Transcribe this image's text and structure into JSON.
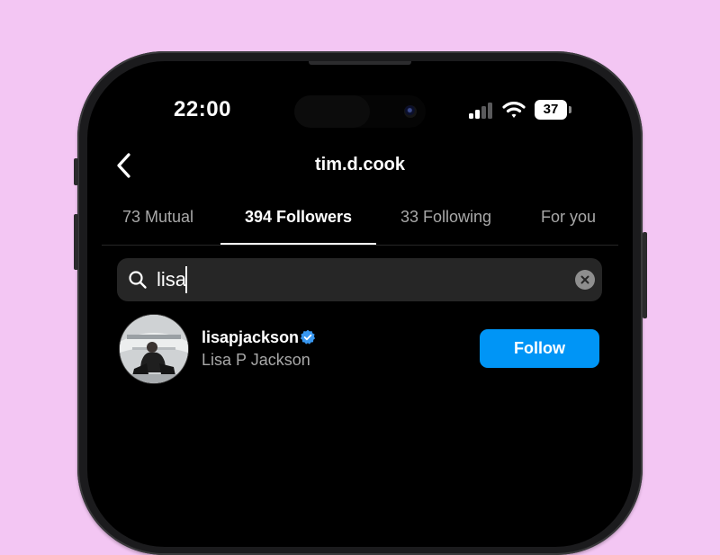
{
  "status_bar": {
    "time": "22:00",
    "battery_level": "37",
    "icons": [
      "cellular-signal-icon",
      "wifi-icon",
      "battery-icon"
    ]
  },
  "header": {
    "title": "tim.d.cook",
    "back_icon": "chevron-left-icon"
  },
  "tabs": [
    {
      "label": "73 Mutual",
      "active": false
    },
    {
      "label": "394 Followers",
      "active": true
    },
    {
      "label": "33 Following",
      "active": false
    },
    {
      "label": "For you",
      "active": false
    }
  ],
  "search": {
    "value": "lisa",
    "icons": [
      "search-icon",
      "clear-icon"
    ]
  },
  "results": [
    {
      "username": "lisapjackson",
      "full_name": "Lisa P Jackson",
      "verified": true,
      "action_label": "Follow"
    }
  ],
  "colors": {
    "background": "#f3c6f3",
    "screen": "#000000",
    "accent_blue": "#0095f6",
    "secondary_text": "#a8a8a8",
    "search_field": "#262626"
  }
}
